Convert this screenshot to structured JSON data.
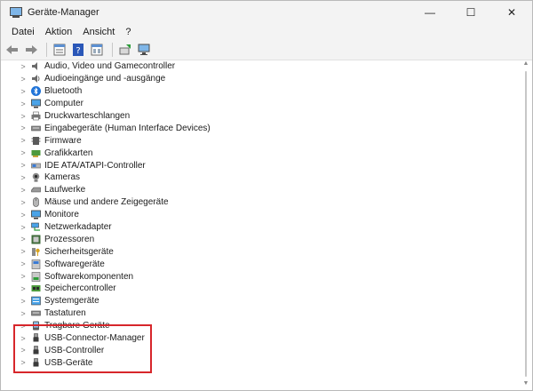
{
  "window": {
    "title": "Geräte-Manager",
    "caption": {
      "minimize": "—",
      "maximize": "☐",
      "close": "✕"
    }
  },
  "menu": {
    "items": [
      "Datei",
      "Aktion",
      "Ansicht",
      "?"
    ]
  },
  "toolbar": {
    "icons": [
      "arrow-left-icon",
      "arrow-right-icon",
      "properties-icon",
      "help-icon",
      "view-icon",
      "update-driver-icon",
      "scan-hardware-icon"
    ]
  },
  "tree": {
    "items": [
      {
        "label": "Audio, Video und Gamecontroller",
        "icon": "speaker-icon"
      },
      {
        "label": "Audioeingänge und -ausgänge",
        "icon": "speaker-icon"
      },
      {
        "label": "Bluetooth",
        "icon": "bluetooth-icon"
      },
      {
        "label": "Computer",
        "icon": "monitor-icon"
      },
      {
        "label": "Druckwarteschlangen",
        "icon": "printer-icon"
      },
      {
        "label": "Eingabegeräte (Human Interface Devices)",
        "icon": "keyboard-icon"
      },
      {
        "label": "Firmware",
        "icon": "chip-icon"
      },
      {
        "label": "Grafikkarten",
        "icon": "graphics-card-icon"
      },
      {
        "label": "IDE ATA/ATAPI-Controller",
        "icon": "drive-controller-icon"
      },
      {
        "label": "Kameras",
        "icon": "camera-icon"
      },
      {
        "label": "Laufwerke",
        "icon": "disk-drive-icon"
      },
      {
        "label": "Mäuse und andere Zeigegeräte",
        "icon": "mouse-icon"
      },
      {
        "label": "Monitore",
        "icon": "monitor-icon"
      },
      {
        "label": "Netzwerkadapter",
        "icon": "network-icon"
      },
      {
        "label": "Prozessoren",
        "icon": "processor-icon"
      },
      {
        "label": "Sicherheitsgeräte",
        "icon": "security-key-icon"
      },
      {
        "label": "Softwaregeräte",
        "icon": "software-device-icon"
      },
      {
        "label": "Softwarekomponenten",
        "icon": "software-component-icon"
      },
      {
        "label": "Speichercontroller",
        "icon": "storage-controller-icon"
      },
      {
        "label": "Systemgeräte",
        "icon": "system-device-icon"
      },
      {
        "label": "Tastaturen",
        "icon": "keyboard-icon"
      },
      {
        "label": "Tragbare Geräte",
        "icon": "portable-device-icon"
      },
      {
        "label": "USB-Connector-Manager",
        "icon": "usb-plug-icon"
      },
      {
        "label": "USB-Controller",
        "icon": "usb-plug-icon"
      },
      {
        "label": "USB-Geräte",
        "icon": "usb-plug-icon"
      }
    ]
  },
  "colors": {
    "highlight": "#d7262b",
    "accent": "#1f73d8"
  }
}
